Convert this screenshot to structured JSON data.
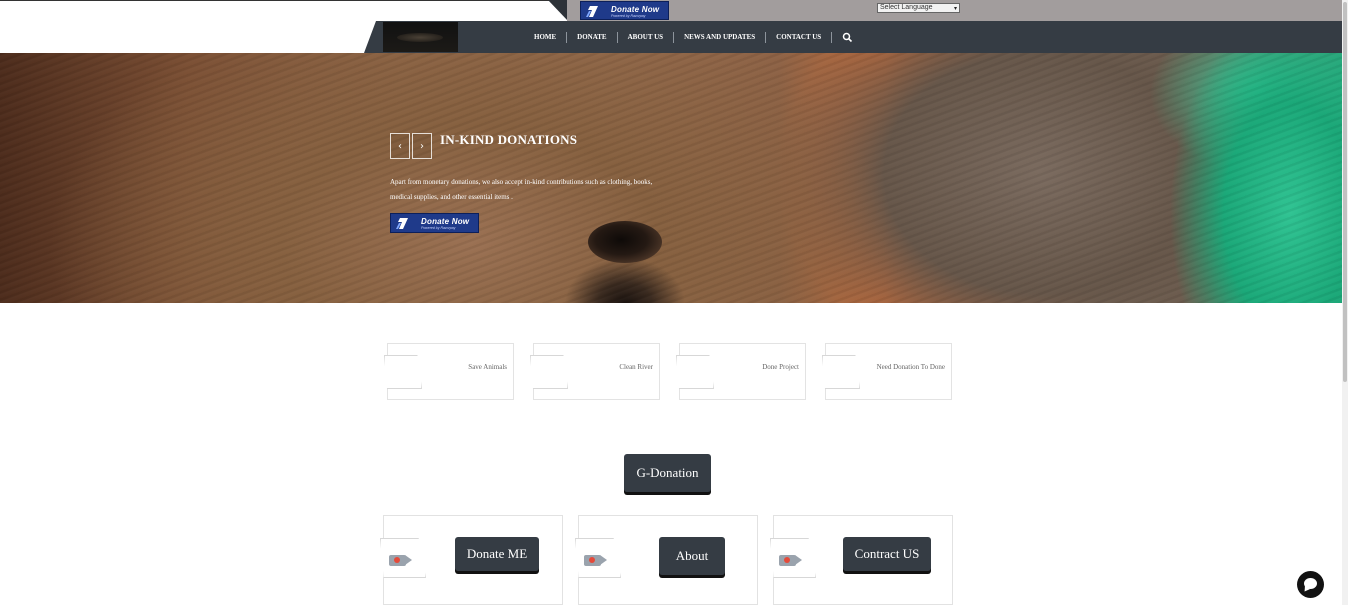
{
  "topbar": {
    "donate_button": {
      "title": "Donate Now",
      "subtitle": "Powered by Razorpay"
    },
    "language_select": {
      "value": "Select Language"
    }
  },
  "nav": {
    "items": [
      "HOME",
      "DONATE",
      "ABOUT US",
      "NEWS AND UPDATES",
      "CONTACT US"
    ],
    "search_icon": "search-icon"
  },
  "hero": {
    "title": "IN-KIND DONATIONS",
    "text": "Apart from monetary donations, we also accept in-kind contributions such as clothing, books, medical supplies, and other essential items .",
    "prev_icon": "‹",
    "next_icon": "›",
    "donate_button": {
      "title": "Donate Now",
      "subtitle": "Powered by Razorpay"
    }
  },
  "features": [
    {
      "label": "Save Animals"
    },
    {
      "label": "Clean River"
    },
    {
      "label": "Done Project"
    },
    {
      "label": "Need Donation To Done"
    }
  ],
  "gdonation": {
    "label": "G-Donation"
  },
  "actions": [
    {
      "label": "Donate ME",
      "icon": "video-camera-icon"
    },
    {
      "label": "About",
      "icon": "video-camera-icon"
    },
    {
      "label": "Contract US",
      "icon": "video-camera-icon"
    }
  ],
  "colors": {
    "nav_bg": "#353c44",
    "topbar_bg": "#a29d9d",
    "donate_blue": "#1f3a8a",
    "button_dark": "#353c44"
  }
}
